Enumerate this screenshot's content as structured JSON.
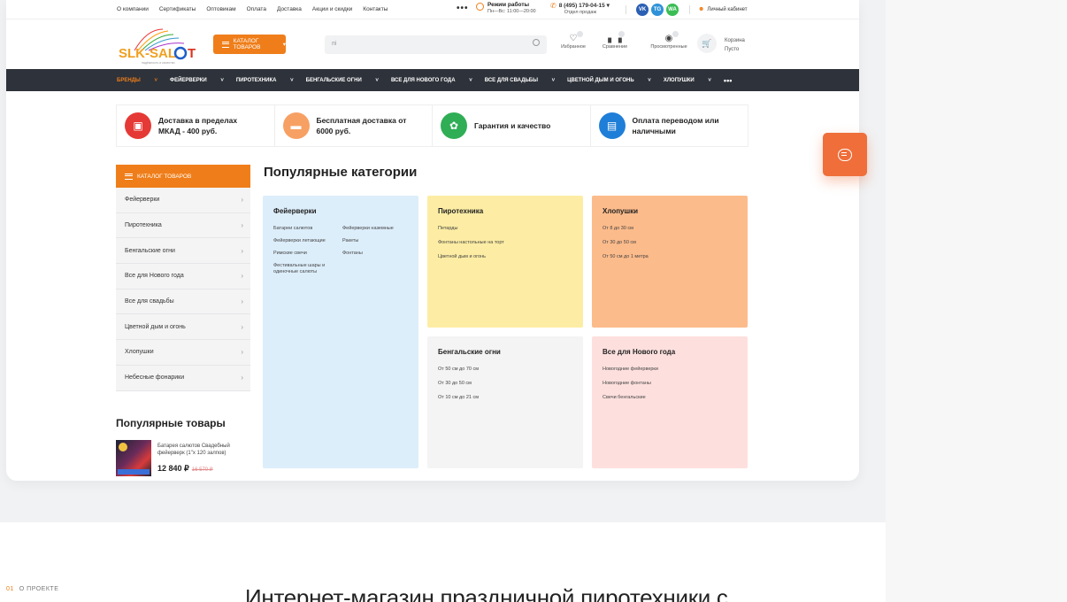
{
  "topbar": {
    "links": [
      "О компании",
      "Сертификаты",
      "Оптовикам",
      "Оплата",
      "Доставка",
      "Акции и скидки",
      "Контакты"
    ],
    "more": "•••",
    "hours_title": "Режим работы",
    "hours_value": "Пн—Вс: 11:00—20:00",
    "phone": "8 (495) 179-04-15",
    "phone_note": "Отдел продаж",
    "social": [
      "VK",
      "TG",
      "WA"
    ],
    "cabinet": "Личный кабинет"
  },
  "header": {
    "logo_text": "SLK-SALUT",
    "logo_tagline": "надёжность и качество",
    "catalog_button": "КАТАЛОГ ТОВАРОВ",
    "search_value": "пі",
    "favorites": "Избранное",
    "compare": "Сравнение",
    "viewed": "Просмотренные",
    "cart_title": "Корзина",
    "cart_status": "Пусто"
  },
  "nav": [
    "БРЕНДЫ",
    "ФЕЙЕРВЕРКИ",
    "ПИРОТЕХНИКА",
    "БЕНГАЛЬСКИЕ ОГНИ",
    "ВСЕ ДЛЯ НОВОГО ГОДА",
    "ВСЕ ДЛЯ СВАДЬБЫ",
    "ЦВЕТНОЙ ДЫМ И ОГОНЬ",
    "ХЛОПУШКИ",
    "•••"
  ],
  "benefits": [
    {
      "text": "Доставка в пределах МКАД - 400 руб.",
      "icon": "cart-icon",
      "color": "#e53935"
    },
    {
      "text": "Бесплатная доставка от 6000 руб.",
      "icon": "truck-icon",
      "color": "#f7a063"
    },
    {
      "text": "Гарантия и качество",
      "icon": "award-icon",
      "color": "#2fae55"
    },
    {
      "text": "Оплата переводом или наличными",
      "icon": "card-icon",
      "color": "#1f7ed8"
    }
  ],
  "sidebar": {
    "title": "КАТАЛОГ ТОВАРОВ",
    "items": [
      "Фейерверки",
      "Пиротехника",
      "Бенгальские огни",
      "Все для Нового года",
      "Все для свадьбы",
      "Цветной дым и огонь",
      "Хлопушки",
      "Небесные фонарики"
    ]
  },
  "popular_goods": {
    "title": "Популярные товары",
    "product_name": "Батарея салютов Свадебный фейерверк (1\"х 120 залпов)",
    "price": "12 840 ₽",
    "old_price": "16 570 ₽"
  },
  "popular_categories": {
    "title": "Популярные категории",
    "cards": [
      {
        "title": "Фейерверки",
        "items": [
          "Батареи салютов",
          "Фейерверки наземные",
          "Фейерверки летающие",
          "Ракеты",
          "Римские свечи",
          "Фонтаны",
          "Фестивальные шары и одиночные салюты"
        ],
        "bg": "#ddeefb"
      },
      {
        "title": "Пиротехника",
        "items": [
          "Петарды",
          "Фонтаны настольные на торт",
          "Цветной дым и огонь"
        ],
        "bg": "#fdeda4"
      },
      {
        "title": "Хлопушки",
        "items": [
          "От 8 до 30 см",
          "От 30 до 50 см",
          "От 50 см до 1 метра"
        ],
        "bg": "#fcbb8b"
      },
      {
        "title": "Бенгальские огни",
        "items": [
          "От 50 см до 70 см",
          "От 30 до 50 см",
          "От 10 см до 21 см"
        ],
        "bg": "#f4f4f4"
      },
      {
        "title": "Все для Нового года",
        "items": [
          "Новогодние фейерверки",
          "Новогодние фонтаны",
          "Свечи бенгальские"
        ],
        "bg": "#fde0de"
      }
    ]
  },
  "about": {
    "number": "01",
    "label": "О ПРОЕКТЕ"
  },
  "headline": "Интернет-магазин праздничной пиротехники с",
  "colors": {
    "accent": "#ef7e1a",
    "nav_bg": "#2e323a",
    "chat": "#ef6e3a"
  }
}
